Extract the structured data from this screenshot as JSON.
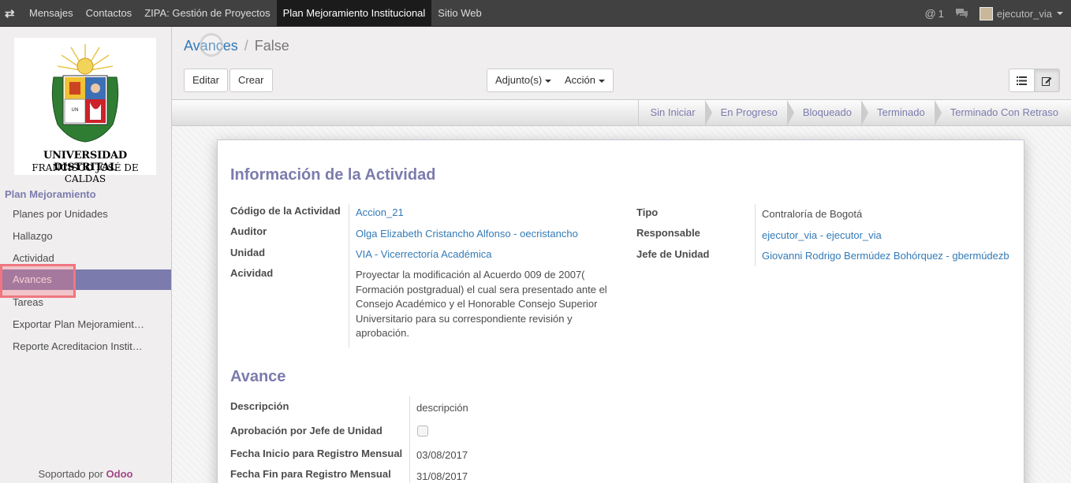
{
  "topbar": {
    "menu": [
      "Mensajes",
      "Contactos",
      "ZIPA: Gestión de Proyectos",
      "Plan Mejoramiento Institucional",
      "Sitio Web"
    ],
    "active_index": 3,
    "notifications": "1",
    "user": "ejecutor_via"
  },
  "sidebar": {
    "logo_line1": "UNIVERSIDAD DISTRITAL",
    "logo_line2": "FRANCISCO JOSÉ DE CALDAS",
    "header": "Plan Mejoramiento",
    "items": [
      "Planes por Unidades",
      "Hallazgo",
      "Actividad",
      "Avances",
      "Tareas",
      "Exportar Plan Mejoramient…",
      "Reporte Acreditacion Instit…"
    ],
    "active_item": "Avances",
    "footer_prefix": "Soportado por",
    "footer_brand": "Odoo"
  },
  "breadcrumb": {
    "parent": "Avances",
    "current": "False"
  },
  "toolbar": {
    "edit": "Editar",
    "create": "Crear",
    "attachments": "Adjunto(s)",
    "action": "Acción"
  },
  "stages": [
    "Sin Iniciar",
    "En Progreso",
    "Bloqueado",
    "Terminado",
    "Terminado Con Retraso"
  ],
  "form": {
    "section1_title": "Información de la Actividad",
    "left": [
      {
        "label": "Código de la Actividad",
        "value": "Accion_21"
      },
      {
        "label": "Auditor",
        "value": "Olga Elizabeth Cristancho Alfonso - oecristancho"
      },
      {
        "label": "Unidad",
        "value": "VIA - Vicerrectoría Académica"
      },
      {
        "label": "Acividad",
        "value": "Proyectar  la modificación al Acuerdo 009 de 2007( Formación postgradual) el cual sera presentado ante el Consejo Académico y el Honorable Consejo Superior Universitario para su correspondiente revisión y aprobación."
      }
    ],
    "right": [
      {
        "label": "Tipo",
        "value": "Contraloría de Bogotá"
      },
      {
        "label": "Responsable",
        "value": "ejecutor_via - ejecutor_via"
      },
      {
        "label": "Jefe de Unidad",
        "value": "Giovanni Rodrigo Bermúdez Bohórquez - gbermúdezb"
      }
    ],
    "section2_title": "Avance",
    "avance": [
      {
        "label": "Descripción",
        "value": "descripción"
      },
      {
        "label": "Aprobación por Jefe de Unidad",
        "value": false
      },
      {
        "label": "Fecha Inicio para Registro Mensual",
        "value": "03/08/2017"
      },
      {
        "label": "Fecha Fin para Registro Mensual",
        "value": "31/08/2017"
      }
    ]
  },
  "colors": {
    "navbar": "#414141",
    "accent": "#7c7bad",
    "link": "#337ab7",
    "highlight": "#f07680"
  }
}
